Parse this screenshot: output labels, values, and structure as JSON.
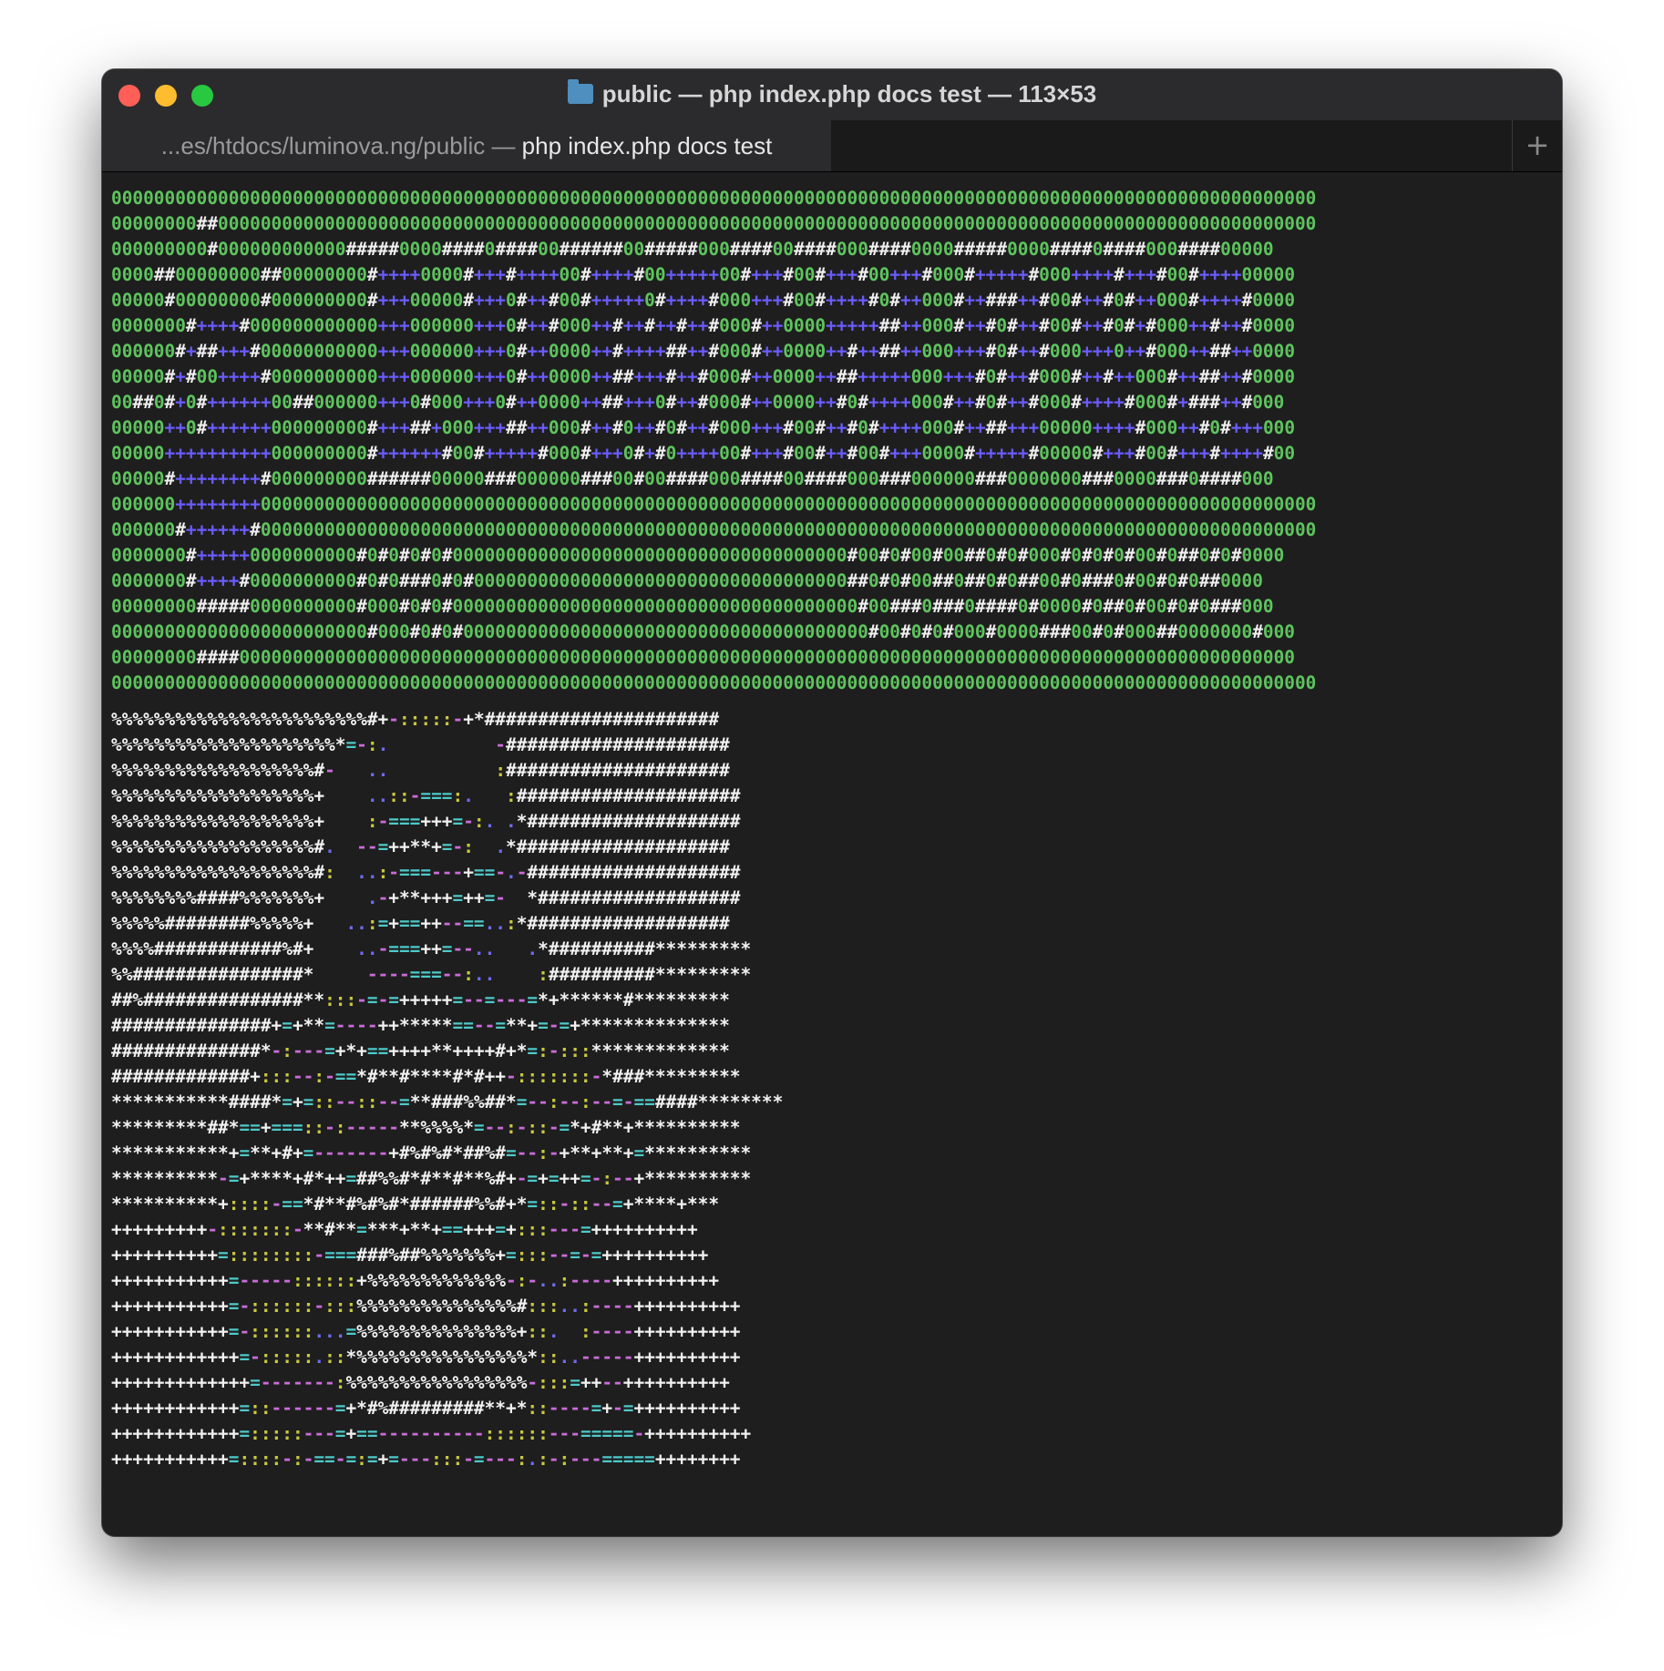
{
  "window": {
    "title": "public — php index.php docs test — 113×53"
  },
  "tab": {
    "path": "...es/htdocs/luminova.ng/public — ",
    "command": "php index.php docs test",
    "new_tab_label": "+"
  },
  "terminal": {
    "logo_lines": [
      "00000000000000000000000000000000000000000000000000000000000000000000000000000000000000000000000000000000000000000",
      "00000000##0000000000000000000000000000000000000000000000000000000000000000000000000000000000000000000000000000000",
      "000000000#000000000000#####0000####0####00######00#####000####00####000####0000#####0000####0####000####00000",
      "0000##00000000##00000000#++++0000#+++#++++00#++++#00+++++00#+++#00#+++#00+++#000#+++++#000++++#+++#00#++++00000",
      "00000#00000000#000000000#+++00000#+++0#++#00#+++++0#++++#000+++#00#++++#0#++000#++###++#00#++#0#++000#++++#0000",
      "0000000#++++#000000000000+++000000+++0#++#000++#++#++#++#000#++0000+++++##++000#++#0#++#00#++#0#+#000++#++#0000",
      "000000#+##+++#00000000000+++000000+++0#++0000++#++++##++#000#++0000++#++##++000+++#0#++#000+++0++#000++##++0000",
      "00000#+#00++++#0000000000+++000000+++0#++0000++##+++#++#000#++0000++##+++++000+++#0#++#000#++#++000#++##++#0000",
      "00##0#+0#++++++00##000000+++0#000+++0#++0000++##+++0#++#000#++0000++#0#++++000#++#0#++#000#++++#000#+###++#000",
      "00000++0#++++++000000000#+++##+000+++##++000#++#0++#0#++#000+++#00#++#0#++++000#++##+++00000++++#000++#0#+++000",
      "00000++++++++++000000000#++++++#00#+++++#000#+++0#+#0++++00#+++#00#++#00#+++0000#+++++#00000#+++#00#+++#++++#00",
      "00000#++++++++#000000000######00000###000000###00#00####000####00####000###000000###0000000###0000###0####000",
      "000000++++++++000000000000000000000000000000000000000000000000000000000000000000000000000000000000000000000000000",
      "000000#++++++#000000000000000000000000000000000000000000000000000000000000000000000000000000000000000000000000000",
      "0000000#+++++0000000000#0#0#0#0#0000000000000000000000000000000000000#00#0#00#00##0#0#000#0#0#0#00#0##0#0#0000",
      "0000000#++++#0000000000#0#0###0#0#00000000000000000000000000000000000##0#0#00##0##0#0##00#0###0#00#0#0##0000",
      "00000000#####0000000000#000#0#0#00000000000000000000000000000000000000#00###0###0####0#0000#0##0#00#0#0###000",
      "000000000000000000000000#000#0#0#00000000000000000000000000000000000000#00#0#0#000#0000###00#0#000##0000000#000",
      "00000000####000000000000000000000000000000000000000000000000000000000000000000000000000000000000000000000000000",
      "00000000000000000000000000000000000000000000000000000000000000000000000000000000000000000000000000000000000000000"
    ],
    "art_lines": [
      "%%%%%%%%%%%%%%%%%%%%%%%%#+-:::::-+*######################",
      "%%%%%%%%%%%%%%%%%%%%%*=-:.          -#####################",
      "%%%%%%%%%%%%%%%%%%%#-   ..          :#####################",
      "%%%%%%%%%%%%%%%%%%%+    ..::-===:.   :#####################",
      "%%%%%%%%%%%%%%%%%%%+    :-===+++=-:. .*####################",
      "%%%%%%%%%%%%%%%%%%%#.  --=++**+=-:  .*####################",
      "%%%%%%%%%%%%%%%%%%%#:  ..:-===---+==-.-####################",
      "%%%%%%%%####%%%%%%%+    .-+**+++=++=-  *###################",
      "%%%%%########%%%%%+   ..:=+==++--==..:*###################",
      "%%%%############%#+    ..-===++=--..   .*##########*********",
      "%%################*     ----===--:..    :##########*********",
      "##%###############**:::-=-=+++++=--=---=*+******#*********",
      "###############+=+**=----++*****==--=**+=-=+**************",
      "##############*-:---=+*+==++++**++++#+*=:-:::*************",
      "#############+:::--:-==*#**#****#*#++-:::::::-*###*********",
      "***********####*=+=::--::--=**###%%##*=--:--:--=-==####********",
      "*********##*==+===::-:-----**%%%%*=--:-::-=*+#**+**********",
      "***********+=**+#+=-------+#%#%#*##%#=--:-+**+**+=**********",
      "**********-=+****+#*++=##%%#*#**#**%#+-=+=++=-:--+**********",
      "**********+::::-==*#**#%#%#*######%%#+*=::-::--=+****+***",
      "+++++++++-:::::::-**#**=***+**+==+++=+:::---=++++++++++",
      "++++++++++=::::::::-===###%##%%%%%%%+=:::--=-=++++++++++",
      "+++++++++++=-----::::::+%%%%%%%%%%%%%-:-..:----++++++++++",
      "+++++++++++=-::::::-:::%%%%%%%%%%%%%%%#:::..:----++++++++++",
      "+++++++++++=-::::::...=%%%%%%%%%%%%%%%+::.  :----++++++++++",
      "++++++++++++=-:::::.::*%%%%%%%%%%%%%%%%*::..-----++++++++++",
      "+++++++++++++=-------:%%%%%%%%%%%%%%%%%-:::=++--++++++++++",
      "++++++++++++=::------=+*#%#########**+*::----=+-=++++++++++",
      "++++++++++++=:::::---=+==----------::::::---=====-++++++++++",
      "+++++++++++=::::-:-==-=:=+=---:::-=---:.:-:---=====++++++++"
    ]
  },
  "colors": {
    "logo_zero": "#5ec45e",
    "logo_hash": "#f0f0f0",
    "logo_plus": "#6a5cff",
    "art_colon": "#c9c93f",
    "art_dot": "#6f6cf0",
    "art_dash": "#c96cd8",
    "art_equals": "#4ec9c9",
    "art_default": "#f2f2f2"
  }
}
